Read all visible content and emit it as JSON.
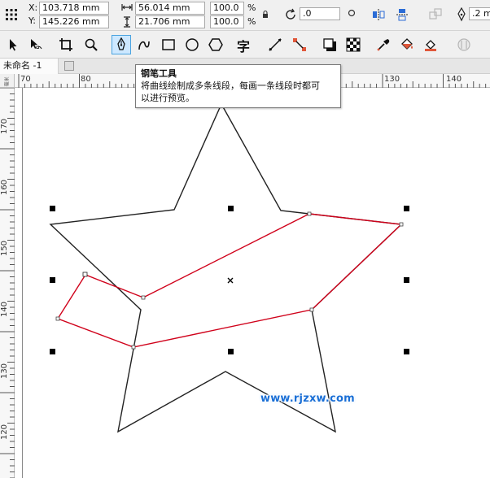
{
  "property_bar": {
    "x_label": "X:",
    "x_value": "103.718 mm",
    "y_label": "Y:",
    "y_value": "145.226 mm",
    "width_value": "56.014 mm",
    "height_value": "21.706 mm",
    "scale_w": "100.0",
    "scale_h": "100.0",
    "percent_symbol": "%",
    "rotation_value": ".0",
    "outline_width": ".2 m"
  },
  "toolbar": {
    "tools": [
      "pick-tool",
      "shape-tool",
      "crop-tool",
      "zoom-tool",
      "pen-tool",
      "artistic-media-tool",
      "rectangle-tool",
      "ellipse-tool",
      "polygon-tool",
      "text-tool",
      "dimension-tool",
      "connector-tool",
      "drop-shadow-tool",
      "transparency-tool",
      "eyedropper-tool",
      "interactive-fill-tool",
      "smart-fill-tool",
      "outline-tool"
    ],
    "text_tool_glyph": "字",
    "active_tool": "pen-tool"
  },
  "document": {
    "tab_label": "未命名 -1"
  },
  "tooltip": {
    "title": "钢笔工具",
    "line1": "将曲线绘制成多条线段，每画一条线段时都可",
    "line2": "以进行预览。"
  },
  "ruler": {
    "top_labels": [
      "70",
      "80",
      "90",
      "130",
      "140"
    ],
    "left_labels": [
      "170",
      "160",
      "150",
      "140",
      "130",
      "120"
    ],
    "unit_glyph": "毫米"
  },
  "watermark": {
    "text": "www.rjzxw.com"
  },
  "colors": {
    "selection_stroke": "#d0021b",
    "star_stroke": "#222222",
    "active_tool_bg": "#cde8ff",
    "watermark": "#1a6fd6"
  }
}
